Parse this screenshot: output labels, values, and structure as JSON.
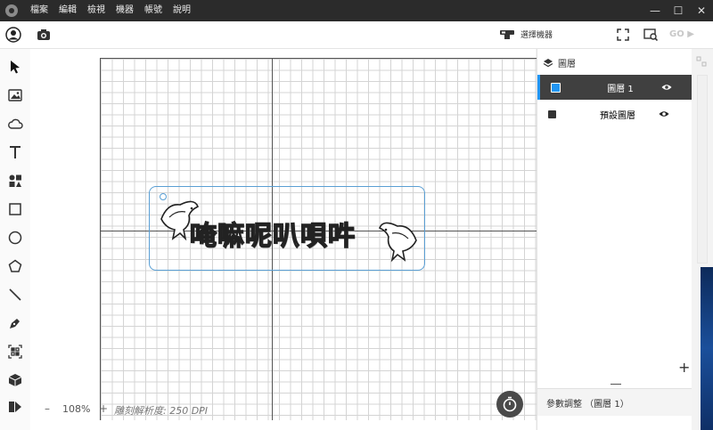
{
  "menu": [
    "檔案",
    "編輯",
    "檢視",
    "機器",
    "帳號",
    "說明"
  ],
  "window_controls": [
    "—",
    "☐",
    "✕"
  ],
  "toolbar": {
    "machine_label": "選擇機器",
    "go_label": "GO ▶"
  },
  "icons": {
    "account": "account-icon",
    "camera": "camera-icon",
    "machine": "machine-icon",
    "fit": "fit-screen-icon",
    "preview": "preview-icon"
  },
  "tools": [
    "select-tool",
    "image-tool",
    "cloud-tool",
    "text-tool",
    "shapes-tool",
    "rectangle-tool",
    "circle-tool",
    "polygon-tool",
    "line-tool",
    "pen-tool",
    "qrcode-tool",
    "3d-box-tool",
    "media-tool"
  ],
  "canvas": {
    "design_text": "唵嘛呢叭唄吽"
  },
  "bottom": {
    "zoom_minus": "–",
    "zoom": "108%",
    "zoom_plus": "+",
    "resolution": "雕刻解析度: 250 DPI"
  },
  "layers_panel": {
    "title": "圖層",
    "layers": [
      {
        "name": "圖層 1",
        "color": "#2196f3",
        "active": true
      },
      {
        "name": "預設圖層",
        "color": "#333333",
        "active": false
      }
    ],
    "add_label": "+"
  },
  "params": {
    "label": "參數調整 （圖層 1）"
  },
  "colors": {
    "accent": "#2196f3",
    "titlebar": "#2b2b2b",
    "frame": "#5a9fd4"
  }
}
